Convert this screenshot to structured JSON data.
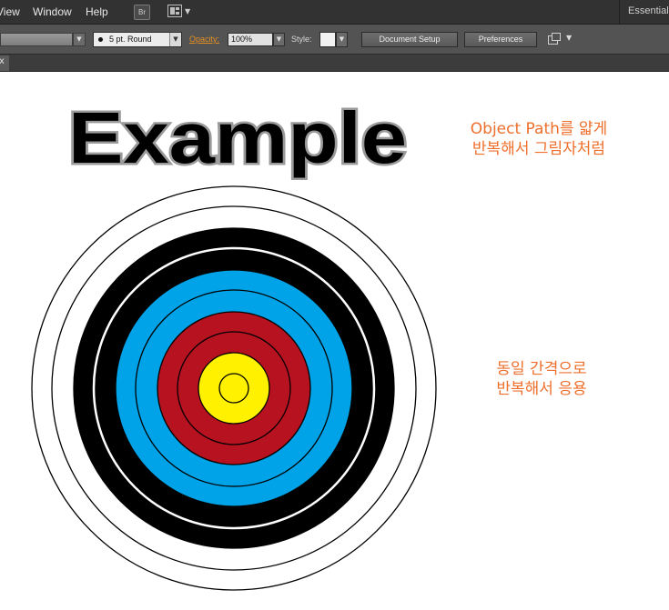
{
  "menubar": {
    "items": [
      "View",
      "Window",
      "Help"
    ],
    "bridge_label": "Br",
    "workspace": "Essentials"
  },
  "control_bar": {
    "brush": "5 pt. Round",
    "opacity_label": "Opacity:",
    "opacity_value": "100%",
    "style_label": "Style:",
    "document_setup": "Document Setup",
    "preferences": "Preferences"
  },
  "tab_close": "x",
  "canvas": {
    "heading": "Example",
    "note_top": [
      "Object Path를 얇게",
      "반복해서 그림자처럼"
    ],
    "note_side": [
      "동일 간격으로",
      "반복해서 응용"
    ]
  },
  "colors": {
    "menubar_bg": "#323232",
    "control_bar_bg": "#535353",
    "accent_orange": "#ee6f2c",
    "target_black": "#000000",
    "target_blue": "#00a3e8",
    "target_red": "#b7121f",
    "target_yellow": "#fff100"
  },
  "target": {
    "rings": [
      {
        "name": "white-outer",
        "fill": "#ffffff"
      },
      {
        "name": "white-inner",
        "fill": "#ffffff"
      },
      {
        "name": "black-outer",
        "fill": "#000000"
      },
      {
        "name": "black-inner",
        "fill": "#000000"
      },
      {
        "name": "blue-outer",
        "fill": "#00a3e8"
      },
      {
        "name": "blue-inner",
        "fill": "#00a3e8"
      },
      {
        "name": "red-outer",
        "fill": "#b7121f"
      },
      {
        "name": "red-inner",
        "fill": "#b7121f"
      },
      {
        "name": "yellow-outer",
        "fill": "#fff100"
      },
      {
        "name": "yellow-inner",
        "fill": "#fff100"
      }
    ]
  }
}
